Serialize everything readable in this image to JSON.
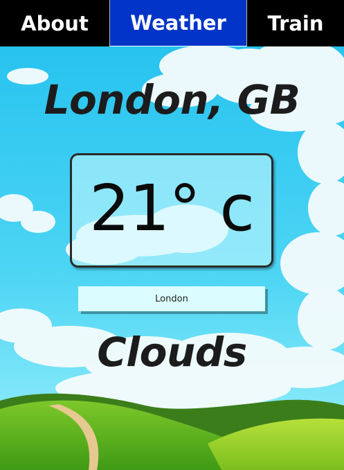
{
  "nav": {
    "tabs": [
      {
        "label": "About",
        "active": false
      },
      {
        "label": "Weather",
        "active": true
      },
      {
        "label": "Train",
        "active": false
      }
    ],
    "active_color": "#0234c8"
  },
  "weather": {
    "location": "London, GB",
    "temperature": "21° c",
    "condition": "Clouds"
  },
  "search": {
    "value": "London"
  },
  "background": {
    "sky_color": "#2fc6f2",
    "hill_color": "#5db51f"
  }
}
